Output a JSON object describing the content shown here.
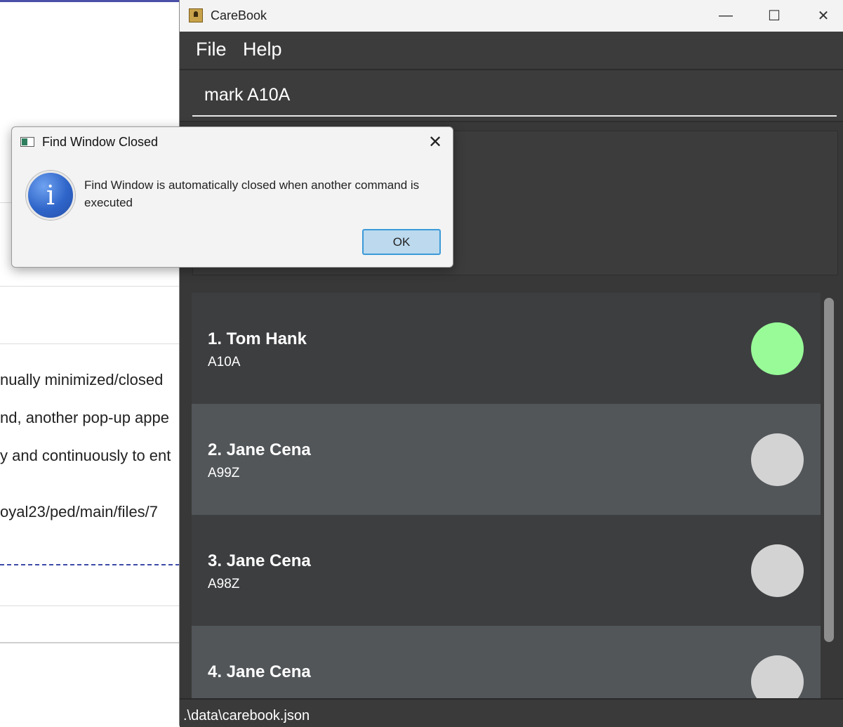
{
  "background_page": {
    "lines": [
      "nually minimized/closed",
      "nd, another pop-up appe",
      "y and continuously to ent",
      "oyal23/ped/main/files/7"
    ]
  },
  "app": {
    "title": "CareBook",
    "window_controls": {
      "minimize": "—",
      "maximize": "☐",
      "close": "✕"
    },
    "menu": [
      "File",
      "Help"
    ],
    "command_input": {
      "value": "mark A10A"
    },
    "persons": [
      {
        "name": "1. Tom Hank",
        "id": "A10A",
        "status_color": "#98fb98"
      },
      {
        "name": "2. Jane Cena",
        "id": "A99Z",
        "status_color": "#d3d3d3"
      },
      {
        "name": "3. Jane Cena",
        "id": "A98Z",
        "status_color": "#d3d3d3"
      },
      {
        "name": "4. Jane Cena",
        "id": "",
        "status_color": "#d3d3d3"
      }
    ],
    "status_bar": {
      "path": ".\\data\\carebook.json"
    }
  },
  "dialog": {
    "title": "Find Window Closed",
    "close_glyph": "✕",
    "icon_glyph": "i",
    "message": "Find Window is automatically closed when another command is executed",
    "ok_label": "OK"
  }
}
